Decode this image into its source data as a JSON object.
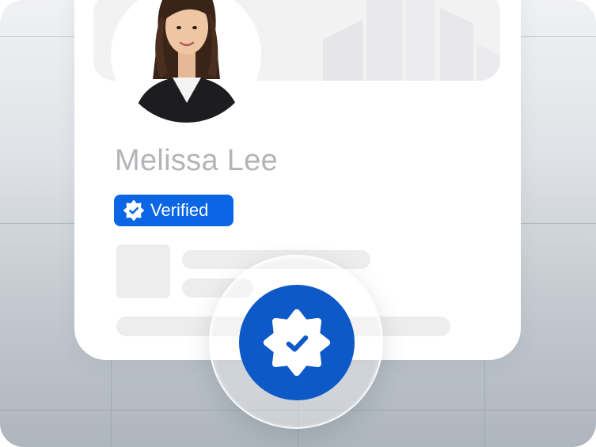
{
  "profile": {
    "name": "Melissa Lee",
    "verified_label": "Verified"
  },
  "icons": {
    "badge_icon": "verified-seal-icon",
    "large_icon": "verified-seal-icon"
  },
  "colors": {
    "accent": "#0a66e4",
    "seal": "#0d59c8",
    "name_text": "#b4b4b8",
    "skeleton": "#ededee"
  }
}
